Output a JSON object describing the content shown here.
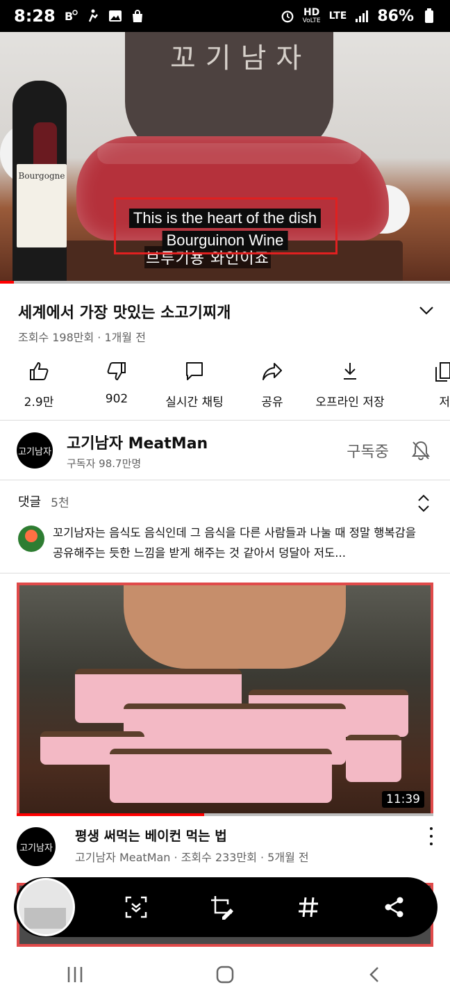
{
  "status_bar": {
    "time": "8:28",
    "battery": "86%",
    "network": "HD",
    "network_sub": "VoLTE",
    "lte": "LTE"
  },
  "video": {
    "apron_text": "꼬기남자",
    "bottle_label": "Bourgogne",
    "caption_line1": "This is the heart of the dish",
    "caption_line2": "Bourguinon Wine",
    "caption_korean": "브루기뇽 와인이죠"
  },
  "video_info": {
    "title": "세계에서 가장 맛있는 소고기찌개",
    "meta": "조회수 198만회 · 1개월 전"
  },
  "actions": [
    {
      "label": "2.9만",
      "icon": "thumbs-up-icon"
    },
    {
      "label": "902",
      "icon": "thumbs-down-icon"
    },
    {
      "label": "실시간 채팅",
      "icon": "chat-icon"
    },
    {
      "label": "공유",
      "icon": "share-icon"
    },
    {
      "label": "오프라인 저장",
      "icon": "download-icon"
    },
    {
      "label": "저",
      "icon": "save-icon"
    }
  ],
  "channel": {
    "avatar_text": "고기남자",
    "name": "고기남자 MeatMan",
    "subscribers": "구독자 98.7만명",
    "subscribe_state": "구독중"
  },
  "comments": {
    "label": "댓글",
    "count": "5천",
    "top_comment": "꼬기남자는 음식도 음식인데 그 음식을 다른 사람들과 나눌 때 정말 행복감을 공유해주는 듯한 느낌을 받게 해주는 것 같아서 덩달아 저도..."
  },
  "next_video": {
    "duration": "11:39",
    "avatar_text": "고기남자",
    "title": "평생 써먹는 베이컨 먹는 법",
    "meta": "고기남자 MeatMan · 조회수 233만회 · 5개월 전"
  },
  "colors": {
    "accent": "#ff0000",
    "highlight_border": "#e02020"
  }
}
